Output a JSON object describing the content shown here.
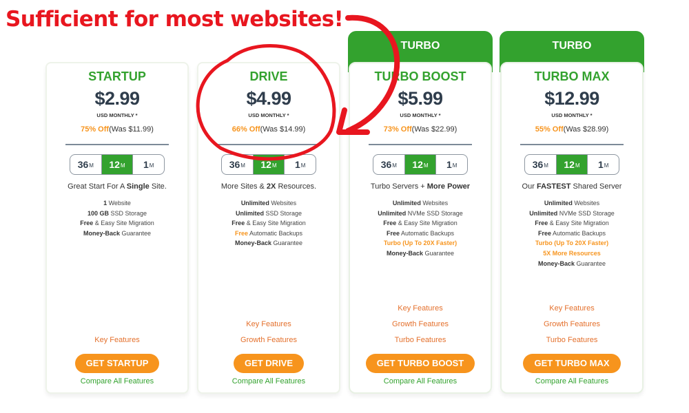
{
  "annotation": {
    "headline": "Sufficient for most websites!",
    "color": "#e8161f"
  },
  "colors": {
    "brand_green": "#33a22e",
    "accent_orange": "#f7941d",
    "link_orange": "#e4702c",
    "price_dark": "#2f3d4c"
  },
  "plans": [
    {
      "badge": null,
      "name": "STARTUP",
      "price": "$2.99",
      "period": "USD MONTHLY *",
      "discount": "75% Off",
      "was": "(Was $11.99)",
      "terms": [
        {
          "value": "36",
          "unit": "M",
          "active": false
        },
        {
          "value": "12",
          "unit": "M",
          "active": true
        },
        {
          "value": "1",
          "unit": "M",
          "active": false
        }
      ],
      "tagline": {
        "pre": "Great Start For A ",
        "bold": "Single",
        "post": " Site."
      },
      "features": [
        {
          "bold": "1",
          "text": " Website",
          "highlight": false
        },
        {
          "bold": "100 GB",
          "text": " SSD Storage",
          "highlight": false
        },
        {
          "bold": "Free",
          "text": " & Easy Site Migration",
          "highlight": false
        },
        {
          "bold": "Money-Back",
          "text": " Guarantee",
          "highlight": false
        }
      ],
      "feature_links": [
        "Key Features"
      ],
      "cta": "GET STARTUP",
      "compare": "Compare All Features"
    },
    {
      "badge": null,
      "name": "DRIVE",
      "price": "$4.99",
      "period": "USD MONTHLY *",
      "discount": "66% Off",
      "was": "(Was $14.99)",
      "terms": [
        {
          "value": "36",
          "unit": "M",
          "active": false
        },
        {
          "value": "12",
          "unit": "M",
          "active": true
        },
        {
          "value": "1",
          "unit": "M",
          "active": false
        }
      ],
      "tagline": {
        "pre": "More Sites & ",
        "bold": "2X",
        "post": " Resources."
      },
      "features": [
        {
          "bold": "Unlimited",
          "text": " Websites",
          "highlight": false
        },
        {
          "bold": "Unlimited",
          "text": " SSD Storage",
          "highlight": false
        },
        {
          "bold": "Free",
          "text": " & Easy Site Migration",
          "highlight": false
        },
        {
          "bold": "Free",
          "text": " Automatic Backups",
          "highlight": "bold-only"
        },
        {
          "bold": "Money-Back",
          "text": " Guarantee",
          "highlight": false
        }
      ],
      "feature_links": [
        "Key Features",
        "Growth Features"
      ],
      "cta": "GET DRIVE",
      "compare": "Compare All Features"
    },
    {
      "badge": "TURBO",
      "name": "TURBO BOOST",
      "price": "$5.99",
      "period": "USD MONTHLY *",
      "discount": "73% Off",
      "was": "(Was $22.99)",
      "terms": [
        {
          "value": "36",
          "unit": "M",
          "active": false
        },
        {
          "value": "12",
          "unit": "M",
          "active": true
        },
        {
          "value": "1",
          "unit": "M",
          "active": false
        }
      ],
      "tagline": {
        "pre": "Turbo Servers + ",
        "bold": "More Power",
        "post": ""
      },
      "features": [
        {
          "bold": "Unlimited",
          "text": " Websites",
          "highlight": false
        },
        {
          "bold": "Unlimited",
          "text": " NVMe SSD Storage",
          "highlight": false
        },
        {
          "bold": "Free",
          "text": " & Easy Site Migration",
          "highlight": false
        },
        {
          "bold": "Free",
          "text": " Automatic Backups",
          "highlight": false
        },
        {
          "bold": "Turbo (Up To 20X Faster)",
          "text": "",
          "highlight": true
        },
        {
          "bold": "Money-Back",
          "text": " Guarantee",
          "highlight": false
        }
      ],
      "feature_links": [
        "Key Features",
        "Growth Features",
        "Turbo Features"
      ],
      "cta": "GET TURBO BOOST",
      "compare": "Compare All Features"
    },
    {
      "badge": "TURBO",
      "name": "TURBO MAX",
      "price": "$12.99",
      "period": "USD MONTHLY *",
      "discount": "55% Off",
      "was": "(Was $28.99)",
      "terms": [
        {
          "value": "36",
          "unit": "M",
          "active": false
        },
        {
          "value": "12",
          "unit": "M",
          "active": true
        },
        {
          "value": "1",
          "unit": "M",
          "active": false
        }
      ],
      "tagline": {
        "pre": "Our ",
        "bold": "FASTEST",
        "post": " Shared Server"
      },
      "features": [
        {
          "bold": "Unlimited",
          "text": " Websites",
          "highlight": false
        },
        {
          "bold": "Unlimited",
          "text": " NVMe SSD Storage",
          "highlight": false
        },
        {
          "bold": "Free",
          "text": " & Easy Site Migration",
          "highlight": false
        },
        {
          "bold": "Free",
          "text": " Automatic Backups",
          "highlight": false
        },
        {
          "bold": "Turbo (Up To 20X Faster)",
          "text": "",
          "highlight": true
        },
        {
          "bold": "5X More Resources",
          "text": "",
          "highlight": true
        },
        {
          "bold": "Money-Back",
          "text": " Guarantee",
          "highlight": false
        }
      ],
      "feature_links": [
        "Key Features",
        "Growth Features",
        "Turbo Features"
      ],
      "cta": "GET TURBO MAX",
      "compare": "Compare All Features"
    }
  ]
}
